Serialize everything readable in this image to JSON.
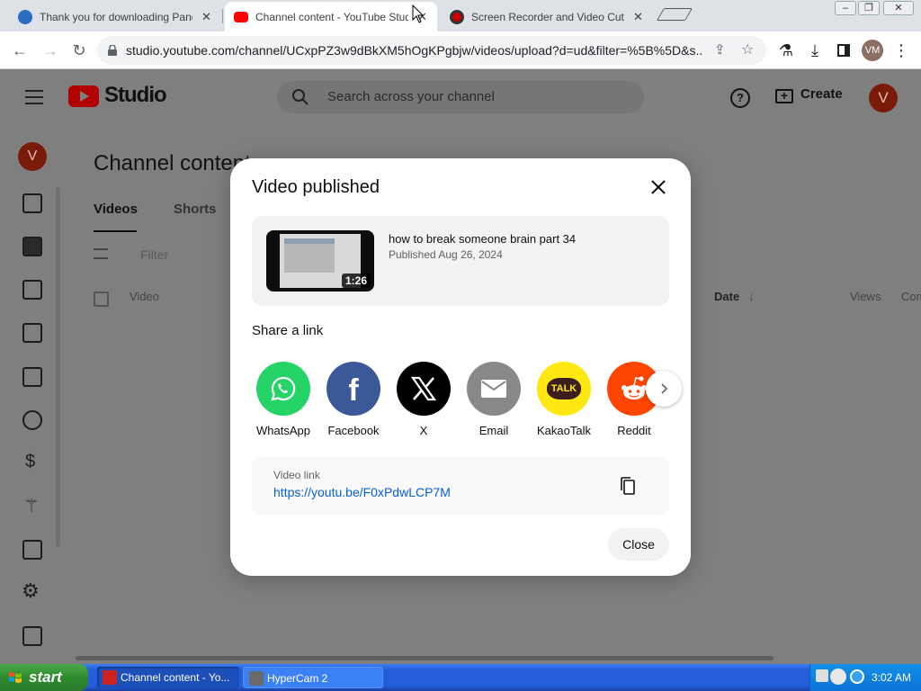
{
  "browser": {
    "tabs": [
      {
        "title": "Thank you for downloading Panda",
        "active": false
      },
      {
        "title": "Channel content - YouTube Studio",
        "active": true
      },
      {
        "title": "Screen Recorder and Video Cutter",
        "active": false
      }
    ],
    "url": "studio.youtube.com/channel/UCxpPZ3w9dBkXM5hOgKPgbjw/videos/upload?d=ud&filter=%5B%5D&s...",
    "profile_initials": "VM"
  },
  "studio": {
    "logo_text": "Studio",
    "search_placeholder": "Search across your channel",
    "create_label": "Create",
    "avatar_letter": "V",
    "page_title": "Channel content",
    "tabs": [
      "Videos",
      "Shorts"
    ],
    "filter_label": "Filter",
    "columns": {
      "video": "Video",
      "date": "Date",
      "views": "Views",
      "comments": "Com"
    }
  },
  "modal": {
    "title": "Video published",
    "video": {
      "title": "how to break someone brain part 34",
      "published": "Published Aug 26, 2024",
      "duration": "1:26"
    },
    "share_heading": "Share a link",
    "share_targets": [
      {
        "label": "WhatsApp",
        "color": "#25d366"
      },
      {
        "label": "Facebook",
        "color": "#3b5998"
      },
      {
        "label": "X",
        "color": "#000000"
      },
      {
        "label": "Email",
        "color": "#888888"
      },
      {
        "label": "KakaoTalk",
        "color": "#ffe812",
        "badge_text": "TALK"
      },
      {
        "label": "Reddit",
        "color": "#ff4500"
      }
    ],
    "link_label": "Video link",
    "link_url": "https://youtu.be/F0xPdwLCP7M",
    "close_label": "Close"
  },
  "taskbar": {
    "start_label": "start",
    "items": [
      {
        "label": "Channel content - Yo...",
        "active": true
      },
      {
        "label": "HyperCam 2",
        "active": false
      }
    ],
    "clock": "3:02 AM"
  }
}
